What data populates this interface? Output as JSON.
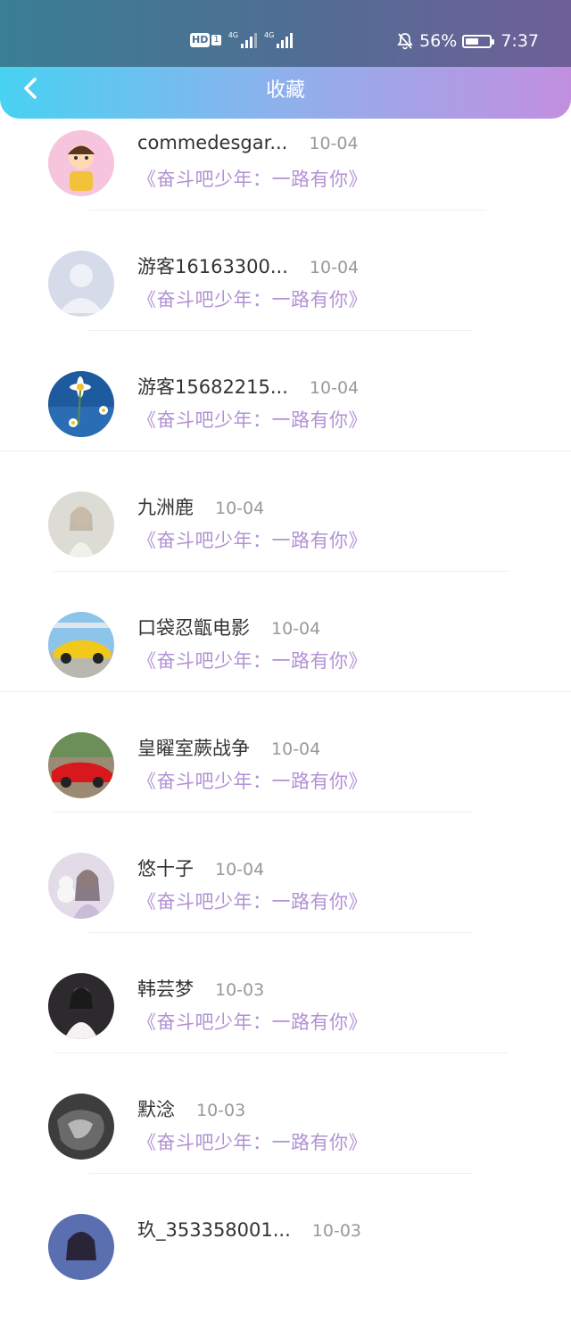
{
  "status_bar": {
    "network_badge": "HD",
    "network_badge_sub": "1",
    "signal_label_1": "4G",
    "signal_label_2": "4G",
    "battery_percent": "56%",
    "battery_level": 0.56,
    "time": "7:37"
  },
  "header": {
    "title": "收藏",
    "back_icon": "chevron-left-icon"
  },
  "colors": {
    "accent_start": "#48d2f2",
    "accent_end": "#c28fe0",
    "title_purple": "#b292d4"
  },
  "favorites": [
    {
      "name": "commedesgar...",
      "date": "10-04",
      "title": "《奋斗吧少年：一路有你》",
      "avatar": "cartoon-boy-avatar"
    },
    {
      "name": "游客16163300...",
      "date": "10-04",
      "title": "《奋斗吧少年：一路有你》",
      "avatar": "default-user-avatar"
    },
    {
      "name": "游客15682215...",
      "date": "10-04",
      "title": "《奋斗吧少年：一路有你》",
      "avatar": "daisy-sky-avatar"
    },
    {
      "name": "九洲鹿",
      "date": "10-04",
      "title": "《奋斗吧少年：一路有你》",
      "avatar": "girl-white-avatar"
    },
    {
      "name": "口袋忍甑电影",
      "date": "10-04",
      "title": "《奋斗吧少年：一路有你》",
      "avatar": "yellow-car-avatar"
    },
    {
      "name": "皇矅室蕨战争",
      "date": "10-04",
      "title": "《奋斗吧少年：一路有你》",
      "avatar": "red-car-avatar"
    },
    {
      "name": "悠十子",
      "date": "10-04",
      "title": "《奋斗吧少年：一路有你》",
      "avatar": "girl-cat-avatar"
    },
    {
      "name": "韩芸梦",
      "date": "10-03",
      "title": "《奋斗吧少年：一路有你》",
      "avatar": "girl-mirror-avatar"
    },
    {
      "name": "默淰",
      "date": "10-03",
      "title": "《奋斗吧少年：一路有你》",
      "avatar": "dark-photo-avatar"
    },
    {
      "name": "玖_353358001...",
      "date": "10-03",
      "title": "",
      "avatar": "girl-blue-avatar"
    }
  ]
}
